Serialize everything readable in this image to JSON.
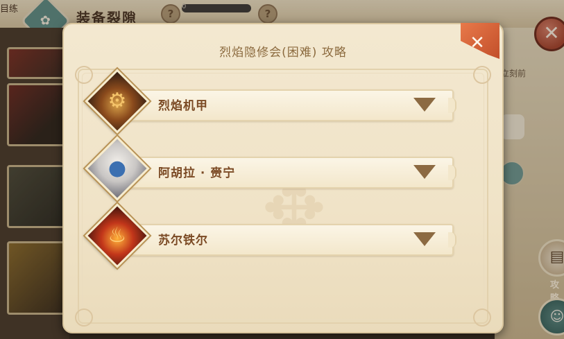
{
  "background": {
    "top_left_text": "目练",
    "title": "装备裂隙",
    "help_glyph": "?",
    "progress_text": "0",
    "side_text": "立刻前",
    "side_button_label": "攻略",
    "close_glyph": "✕"
  },
  "dialog": {
    "title": "烈焰隐修会(困难) 攻略",
    "close_glyph": "✕",
    "watermark_glyph": "✥"
  },
  "bosses": [
    {
      "name": "烈焰机甲",
      "icon": "mech-boss-icon",
      "glyph": "⚙"
    },
    {
      "name": "阿胡拉 · 赍宁",
      "icon": "white-hair-boss-icon",
      "glyph": "●"
    },
    {
      "name": "苏尔铁尔",
      "icon": "fire-demon-boss-icon",
      "glyph": "♨"
    }
  ],
  "colors": {
    "dialog_bg": "#f3e8d0",
    "title_text": "#8b6a3e",
    "boss_text": "#7b4a24",
    "arrow": "#8c6a42",
    "close_ribbon": "#d9653a"
  }
}
